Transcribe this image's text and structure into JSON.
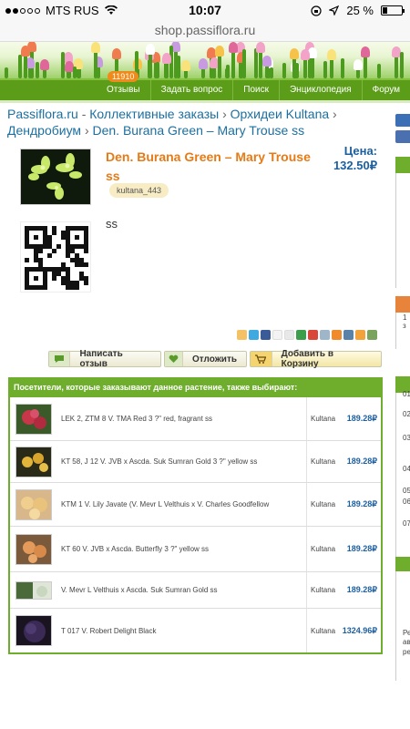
{
  "status_bar": {
    "carrier": "MTS RUS",
    "time": "10:07",
    "battery": "25 %",
    "battery_level": 0.25
  },
  "url_bar": {
    "url": "shop.passiflora.ru"
  },
  "nav": {
    "badge": "11910",
    "items": [
      "Отзывы",
      "Задать вопрос",
      "Поиск",
      "Энциклопедия",
      "Форум"
    ]
  },
  "breadcrumb": {
    "items": [
      "Passiflora.ru",
      "Коллективные заказы",
      "Орхидеи Kultana",
      "Дендробиум",
      "Den. Burana Green – Mary Trouse ss"
    ]
  },
  "product": {
    "title": "Den. Burana Green – Mary Trouse ss",
    "seller_tag": "kultana_443",
    "price_label": "Цена:",
    "price_value": "132.50₽",
    "description": "ss"
  },
  "actions": {
    "review": "Написать отзыв",
    "postpone": "Отложить",
    "add_to_cart": "Добавить в Корзину"
  },
  "also": {
    "heading": "Посетители, которые заказывают данное растение, также выбирают:",
    "rows": [
      {
        "name": "LEK 2, ZTM 8 V. TMA Red 3 ?\" red, fragrant ss",
        "seller": "Kultana",
        "price": "189.28₽"
      },
      {
        "name": "KT 58, J 12 V. JVB x Ascda. Suk Sumran Gold 3 ?\" yellow ss",
        "seller": "Kultana",
        "price": "189.28₽"
      },
      {
        "name": "KTM 1 V. Lily Javate (V. Mevr L Velthuis x V. Charles Goodfellow",
        "seller": "Kultana",
        "price": "189.28₽"
      },
      {
        "name": "KT 60 V. JVB x Ascda. Butterfly 3 ?\" yellow ss",
        "seller": "Kultana",
        "price": "189.28₽"
      },
      {
        "name": "V. Mevr L Velthuis x Ascda. Suk Sumran Gold ss",
        "seller": "Kultana",
        "price": "189.28₽"
      },
      {
        "name": "T 017 V. Robert Delight Black",
        "seller": "Kultana",
        "price": "1324.96₽"
      }
    ]
  },
  "right_sidebar": {
    "fragments": [
      "1 з",
      "01",
      "02",
      "03",
      "04",
      "05",
      "06",
      "07",
      "Ре",
      "ав",
      "ре"
    ]
  }
}
